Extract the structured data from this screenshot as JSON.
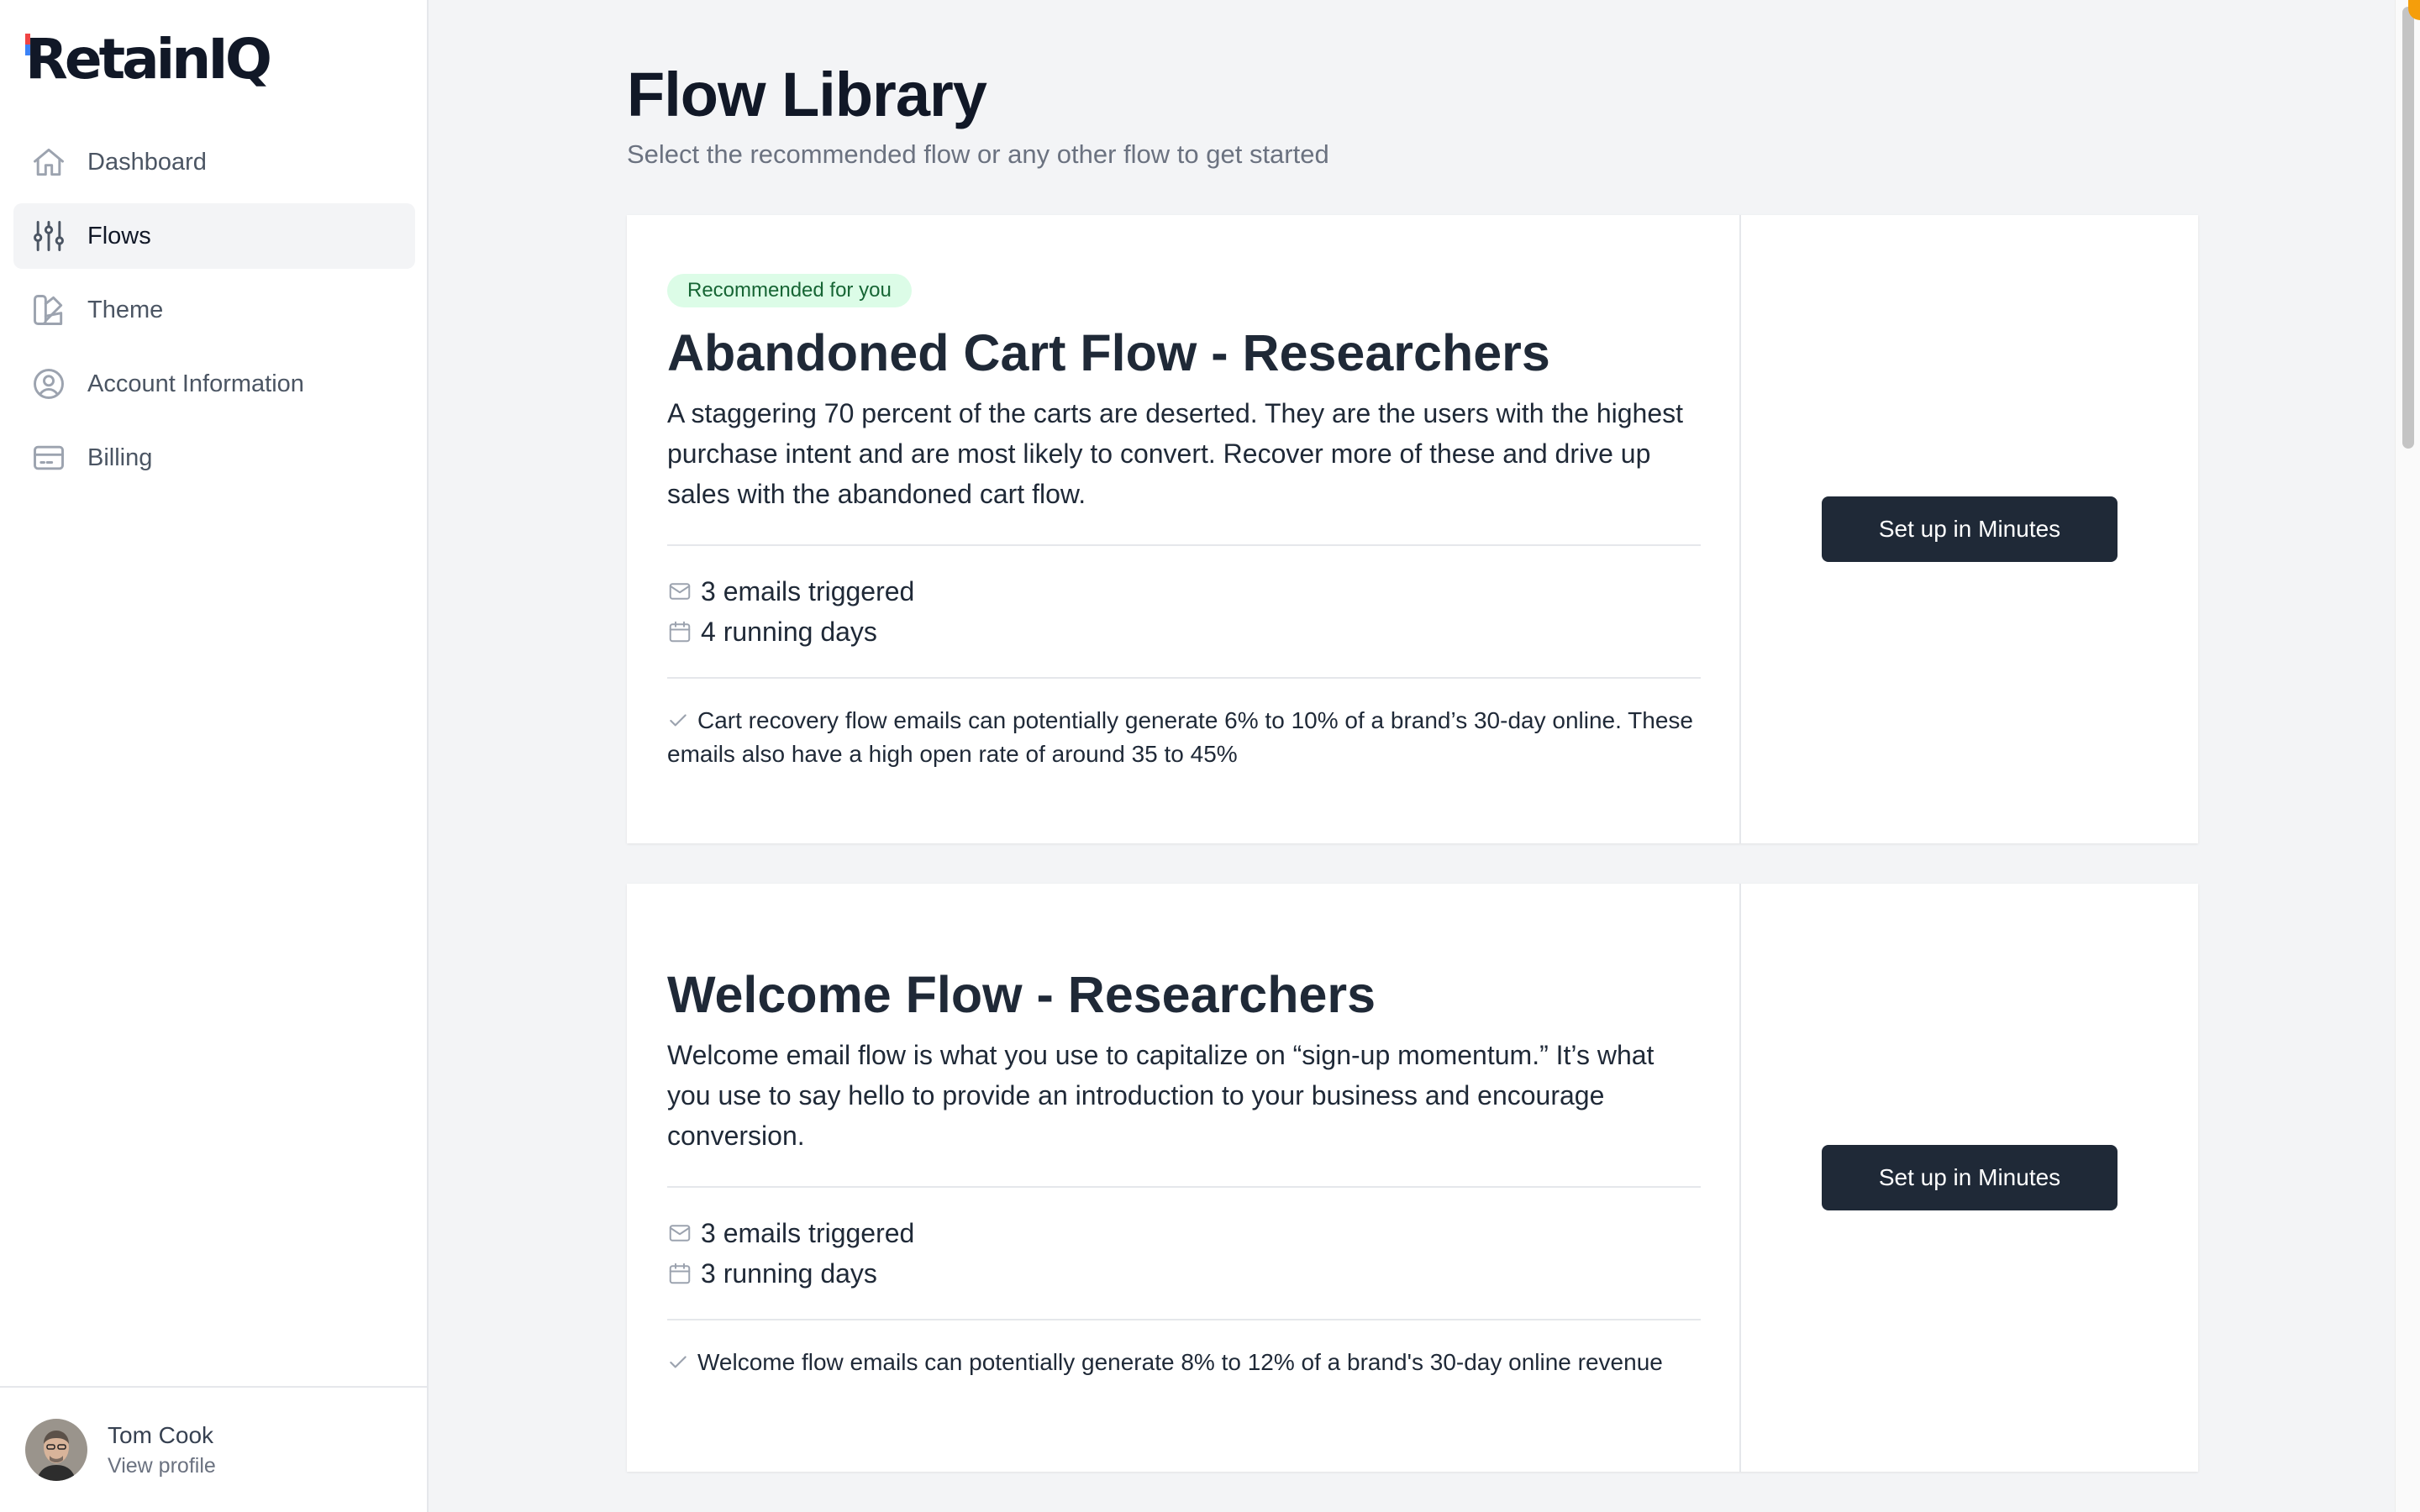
{
  "app": {
    "logo": "RetainIQ"
  },
  "sidebar": {
    "items": [
      {
        "label": "Dashboard",
        "icon": "home-icon",
        "active": false
      },
      {
        "label": "Flows",
        "icon": "sliders-icon",
        "active": true
      },
      {
        "label": "Theme",
        "icon": "swatch-icon",
        "active": false
      },
      {
        "label": "Account Information",
        "icon": "user-circle-icon",
        "active": false
      },
      {
        "label": "Billing",
        "icon": "credit-card-icon",
        "active": false
      }
    ],
    "profile": {
      "name": "Tom Cook",
      "link": "View profile"
    }
  },
  "main": {
    "title": "Flow Library",
    "subtitle": "Select the recommended flow or any other flow to get started",
    "flows": [
      {
        "badge": "Recommended for you",
        "title": "Abandoned Cart Flow - Researchers",
        "description": "A staggering 70 percent of the carts are deserted. They are the users with the highest purchase intent and are most likely to convert. Recover more of these and drive up sales with the abandoned cart flow.",
        "emails": "3 emails triggered",
        "days": "4 running days",
        "note": "Cart recovery flow emails can potentially generate 6% to 10% of a brand’s 30-day online. These emails also have a high open rate of around 35 to 45%",
        "button": "Set up in Minutes"
      },
      {
        "badge": "",
        "title": "Welcome Flow - Researchers",
        "description": "Welcome email flow is what you use to capitalize on “sign-up momentum.” It’s what you use to say hello to provide an introduction to your business and encourage conversion.",
        "emails": "3 emails triggered",
        "days": "3 running days",
        "note": "Welcome flow emails can potentially generate 8% to 12% of a brand's 30-day online revenue",
        "button": "Set up in Minutes"
      }
    ]
  },
  "colors": {
    "primary_button": "#1f2937",
    "badge_bg": "#dcfce7",
    "badge_text": "#166534"
  }
}
